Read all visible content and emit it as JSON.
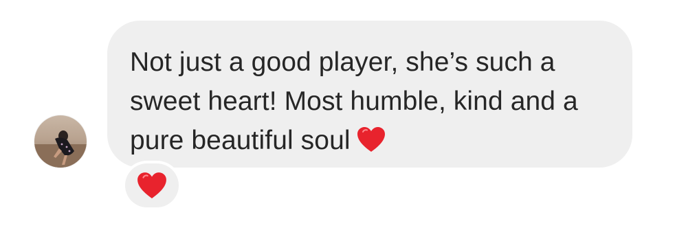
{
  "message": {
    "sender_avatar": "profile-photo",
    "text": "Not just a good player, she’s such a sweet heart! Most humble, kind and a pure beautiful soul",
    "inline_emoji": "red-heart",
    "bubble_color": "#efefef",
    "text_color": "#262626"
  },
  "reaction": {
    "emoji": "red-heart",
    "color": "#e8232d"
  }
}
